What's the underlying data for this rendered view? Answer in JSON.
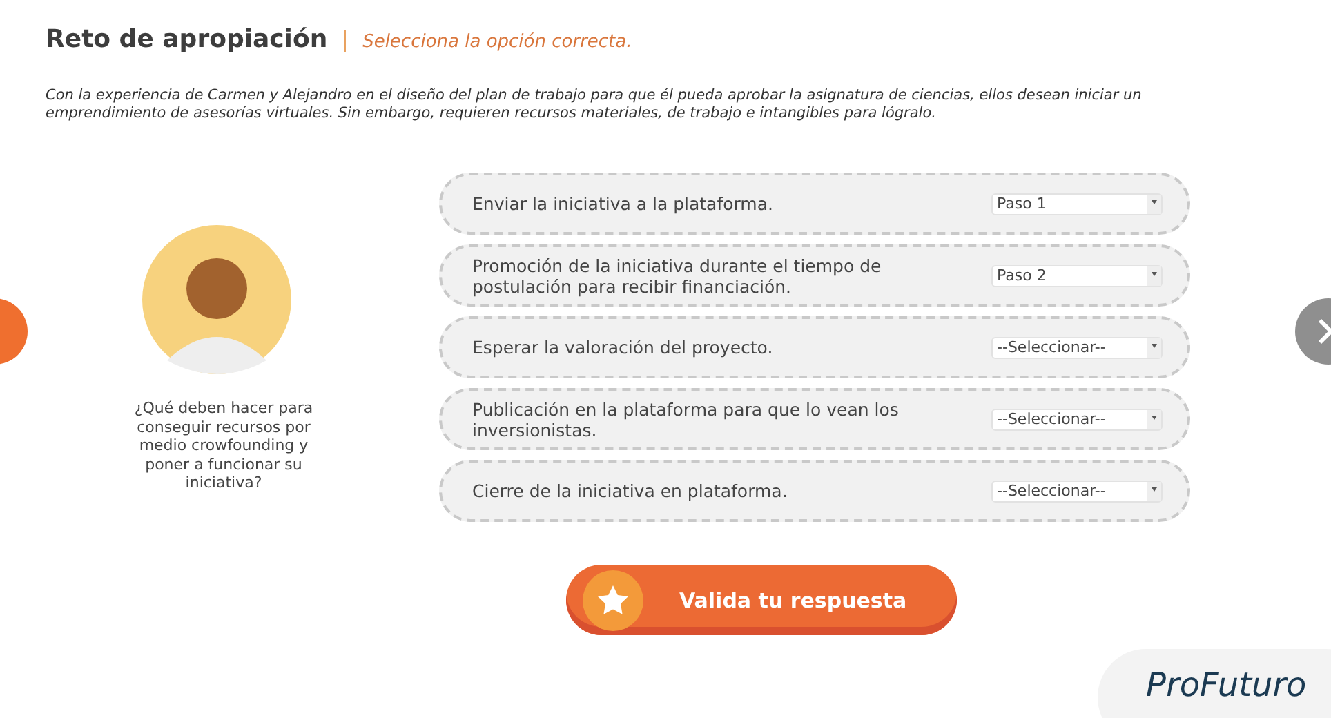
{
  "header": {
    "title": "Reto de apropiación",
    "separator": "|",
    "instruction": "Selecciona la opción correcta."
  },
  "intro": "Con la experiencia de Carmen y Alejandro en el diseño del plan de trabajo para que él pueda aprobar la asignatura de ciencias, ellos desean iniciar un emprendimiento de asesorías virtuales. Sin embargo, requieren recursos materiales, de trabajo e intangibles para lógralo.",
  "question": "¿Qué deben hacer para conseguir recursos por medio crowfounding y poner a funcionar su iniciativa?",
  "options": [
    {
      "text": "Enviar la iniciativa a la plataforma.",
      "value": "Paso 1"
    },
    {
      "text": "Promoción de la iniciativa durante el tiempo de postulación para recibir financiación.",
      "value": "Paso 2"
    },
    {
      "text": "Esperar la valoración del proyecto.",
      "value": "--Seleccionar--"
    },
    {
      "text": "Publicación en la plataforma para que lo vean los inversionistas.",
      "value": "--Seleccionar--"
    },
    {
      "text": "Cierre de la iniciativa en plataforma.",
      "value": "--Seleccionar--"
    }
  ],
  "submit_button": "Valida tu respuesta",
  "logo": "ProFuturo"
}
